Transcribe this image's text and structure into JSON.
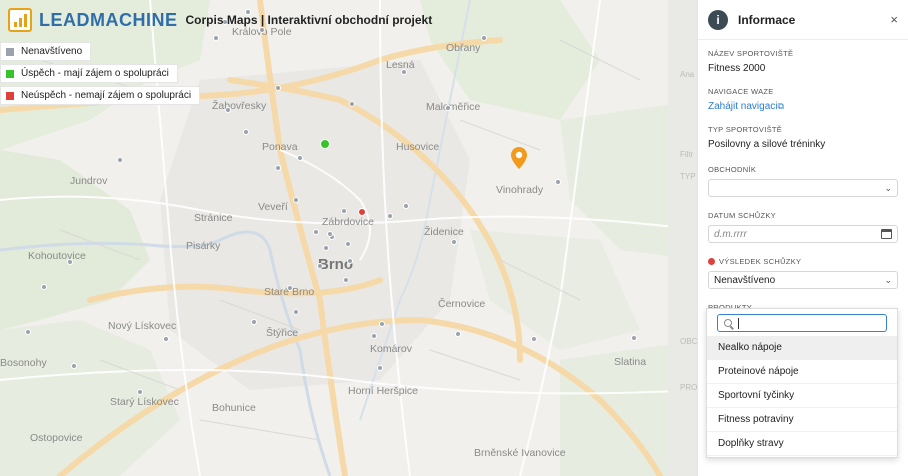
{
  "brand": {
    "name": "LEADMACHINE",
    "subtitle": "Corpis Maps | Interaktivní obchodní projekt"
  },
  "legend": [
    {
      "label": "Nenavštíveno",
      "color": "#9aa3ad"
    },
    {
      "label": "Úspěch - mají zájem o spolupráci",
      "color": "#36c32c"
    },
    {
      "label": "Neúspěch - nemají zájem o spolupráci",
      "color": "#e0403a"
    }
  ],
  "map": {
    "city_label": "Brno",
    "districts": [
      "Královo Pole",
      "Obřany",
      "Lesná",
      "Žabovřesky",
      "Maloměřice",
      "Ponava",
      "Husovice",
      "Jundrov",
      "Vinohrady",
      "Veveří",
      "Stránice",
      "Zábrdovice",
      "Židenice",
      "Pisárky",
      "Kohoutovice",
      "Staré Brno",
      "Černovice",
      "Nový Lískovec",
      "Štýřice",
      "Komárov",
      "Bosonohy",
      "Horní Heršpice",
      "Starý Lískovec",
      "Bohunice",
      "Ostopovice",
      "Slatina",
      "Brněnské Ivanovice"
    ]
  },
  "panel": {
    "title": "Informace",
    "close_label": "×",
    "venue_name_label": "Název sportoviště",
    "venue_name": "Fitness 2000",
    "waze_label": "Navigace Waze",
    "waze_link": "Zahájit navigaci",
    "venue_type_label": "Typ sportoviště",
    "venue_type": "Posilovny a silové tréninky",
    "dealer_label": "Obchodník",
    "dealer_value": "",
    "date_label": "Datum schůzky",
    "date_placeholder": "d.m.rrrr",
    "result_label": "Výsledek schůzky",
    "result_value": "Nenavštíveno",
    "products_label": "Produkty",
    "products_value": ""
  },
  "dropdown": {
    "search_value": "",
    "options": [
      "Nealko nápoje",
      "Proteinové nápoje",
      "Sportovní tyčinky",
      "Fitness potraviny",
      "Doplňky stravy"
    ],
    "active_index": 0
  },
  "background_panel": {
    "labels": [
      "Ana",
      "Filtr",
      "TYP",
      "OBC",
      "PRO"
    ]
  }
}
